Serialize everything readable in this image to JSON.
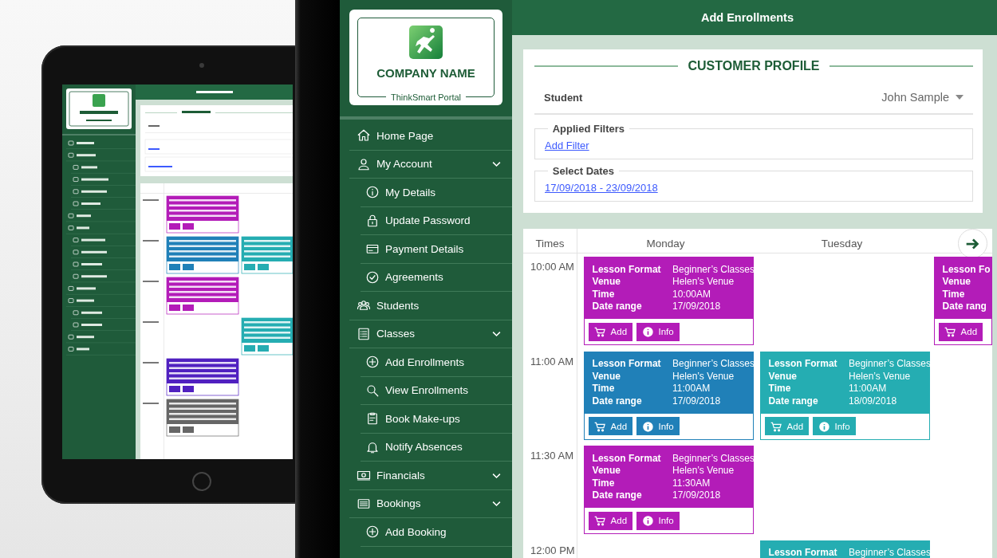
{
  "zoomed_screen": {
    "logo": {
      "company": "COMPANY NAME",
      "portal": "ThinkSmart Portal"
    },
    "header": {
      "title": "Add Enrollments"
    },
    "sidebar": {
      "items": [
        {
          "kind": "home",
          "label": "Home Page",
          "expandable": false
        },
        {
          "kind": "person",
          "label": "My Account",
          "expandable": true,
          "children": [
            {
              "kind": "info",
              "label": "My Details"
            },
            {
              "kind": "lock",
              "label": "Update Password"
            },
            {
              "kind": "card",
              "label": "Payment Details"
            },
            {
              "kind": "check",
              "label": "Agreements"
            }
          ]
        },
        {
          "kind": "people",
          "label": "Students",
          "expandable": false
        },
        {
          "kind": "list",
          "label": "Classes",
          "expandable": true,
          "children": [
            {
              "kind": "plus",
              "label": "Add Enrollments"
            },
            {
              "kind": "search",
              "label": "View Enrollments"
            },
            {
              "kind": "clipboard",
              "label": "Book Make-ups"
            },
            {
              "kind": "bell",
              "label": "Notify Absences"
            }
          ]
        },
        {
          "kind": "money",
          "label": "Financials",
          "expandable": true
        },
        {
          "kind": "bookings",
          "label": "Bookings",
          "expandable": true,
          "children": [
            {
              "kind": "plus",
              "label": "Add Booking"
            }
          ]
        }
      ]
    },
    "customer_profile": {
      "title": "CUSTOMER PROFILE",
      "student": {
        "label": "Student",
        "value": "John Sample"
      },
      "applied_filters": {
        "legend": "Applied Filters",
        "link": "Add Filter"
      },
      "select_dates": {
        "legend": "Select Dates",
        "link": "17/09/2018 - 23/09/2018"
      }
    },
    "calendar": {
      "time_header": "Times",
      "day_headers": [
        "Monday",
        "Tuesday"
      ],
      "next_button": true,
      "rows": [
        {
          "time": "10:00 AM",
          "cells": [
            {
              "color": "#b31cb8",
              "fields": [
                {
                  "label": "Lesson Format",
                  "value": "Beginner’s Classes"
                },
                {
                  "label": "Venue",
                  "value": "Helen’s Venue"
                },
                {
                  "label": "Time",
                  "value": "10:00AM"
                },
                {
                  "label": "Date range",
                  "value": "17/09/2018"
                }
              ],
              "buttons": [
                {
                  "kind": "add",
                  "label": "Add"
                },
                {
                  "kind": "info",
                  "label": "Info"
                }
              ]
            },
            null,
            {
              "color": "#b31cb8",
              "fields": [
                {
                  "label": "Lesson Fo"
                },
                {
                  "label": "Venue"
                },
                {
                  "label": "Time"
                },
                {
                  "label": "Date rang"
                }
              ],
              "buttons": [
                {
                  "kind": "add",
                  "label": "Add"
                }
              ]
            }
          ]
        },
        {
          "time": "11:00 AM",
          "cells": [
            {
              "color": "#2080b8",
              "fields": [
                {
                  "label": "Lesson Format",
                  "value": "Beginner’s Classes"
                },
                {
                  "label": "Venue",
                  "value": "Helen’s Venue"
                },
                {
                  "label": "Time",
                  "value": "11:00AM"
                },
                {
                  "label": "Date range",
                  "value": "17/09/2018"
                }
              ],
              "buttons": [
                {
                  "kind": "add",
                  "label": "Add"
                },
                {
                  "kind": "info",
                  "label": "Info"
                }
              ]
            },
            {
              "color": "#25adb2",
              "fields": [
                {
                  "label": "Lesson Format",
                  "value": "Beginner’s Classes"
                },
                {
                  "label": "Venue",
                  "value": "Helen’s Venue"
                },
                {
                  "label": "Time",
                  "value": "11:00AM"
                },
                {
                  "label": "Date range",
                  "value": "18/09/2018"
                }
              ],
              "buttons": [
                {
                  "kind": "add",
                  "label": "Add"
                },
                {
                  "kind": "info",
                  "label": "Info"
                }
              ]
            },
            null
          ]
        },
        {
          "time": "11:30 AM",
          "cells": [
            {
              "color": "#b31cb8",
              "fields": [
                {
                  "label": "Lesson Format",
                  "value": "Beginner’s Classes"
                },
                {
                  "label": "Venue",
                  "value": "Helen’s Venue"
                },
                {
                  "label": "Time",
                  "value": "11:30AM"
                },
                {
                  "label": "Date range",
                  "value": "17/09/2018"
                }
              ],
              "buttons": [
                {
                  "kind": "add",
                  "label": "Add"
                },
                {
                  "kind": "info",
                  "label": "Info"
                }
              ]
            },
            null,
            null
          ]
        },
        {
          "time": "12:00 PM",
          "cells": [
            null,
            {
              "color": "#25adb2",
              "fields": [
                {
                  "label": "Lesson Format",
                  "value": "Beginner’s Classes"
                }
              ]
            },
            null
          ]
        }
      ]
    }
  }
}
